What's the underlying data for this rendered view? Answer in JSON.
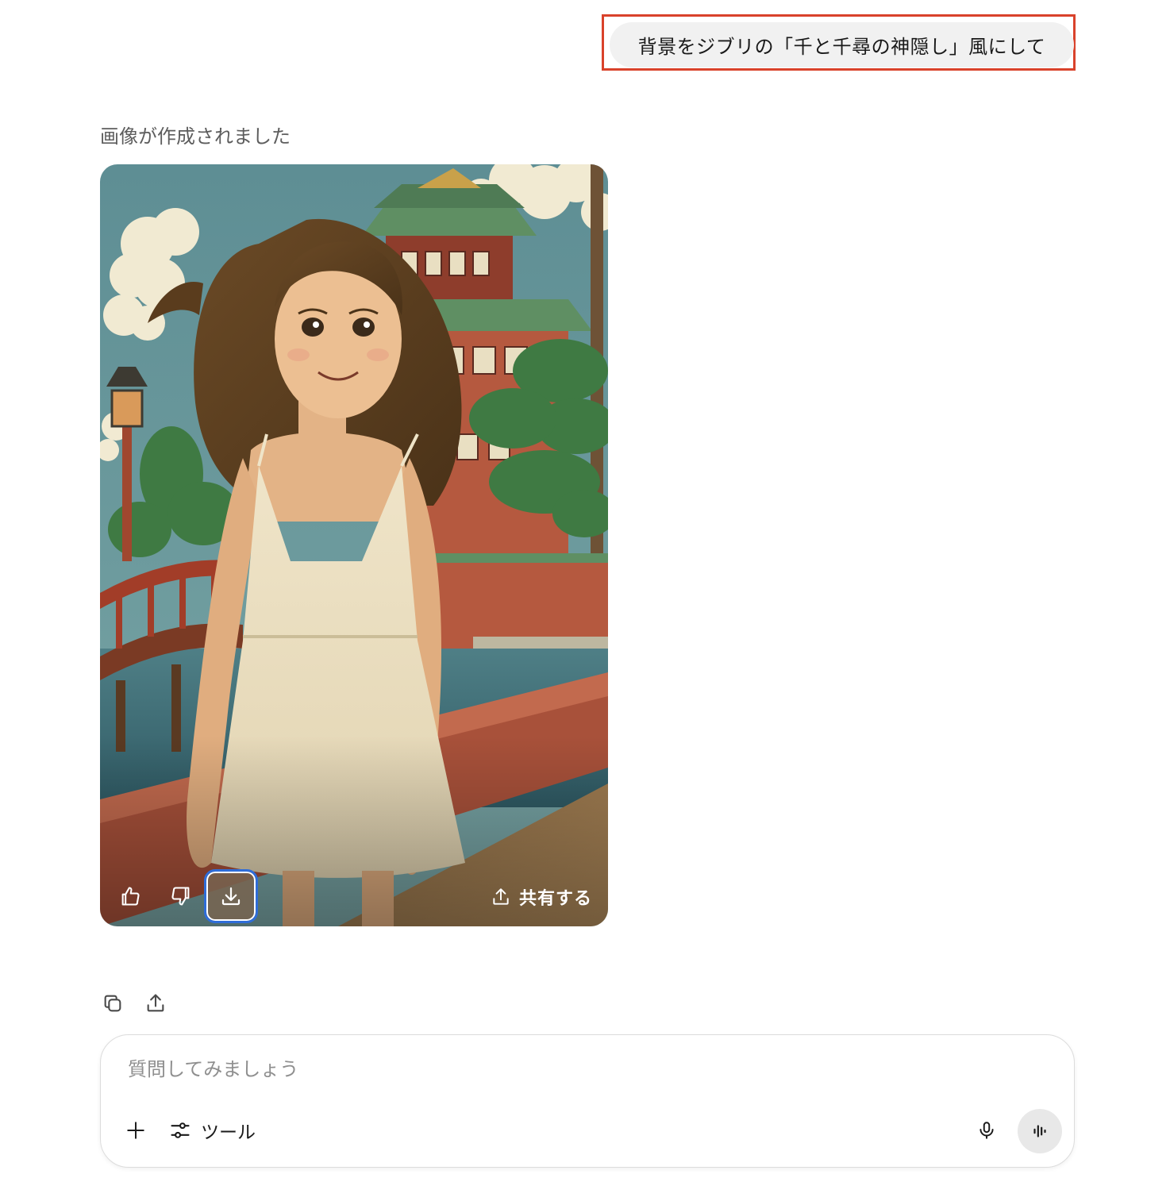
{
  "user_message": {
    "text": "背景をジブリの「千と千尋の神隠し」風にして"
  },
  "assistant": {
    "status": "画像が作成されました",
    "image": {
      "description_icon": "generated-image",
      "actions": {
        "like_icon": "thumbs-up-icon",
        "dislike_icon": "thumbs-down-icon",
        "download_icon": "download-icon",
        "share_label": "共有する",
        "share_icon": "share-icon"
      }
    },
    "message_actions": [
      "copy-icon",
      "share-icon"
    ]
  },
  "composer": {
    "placeholder": "質問してみましょう",
    "tools_label": "ツール",
    "plus_icon": "plus-icon",
    "tools_icon": "sliders-icon",
    "mic_icon": "microphone-icon",
    "voice_icon": "voice-mode-icon"
  },
  "colors": {
    "highlight_border": "#d9422b",
    "bubble_bg": "#f1f1f1",
    "download_focus": "#2f6dd8"
  }
}
